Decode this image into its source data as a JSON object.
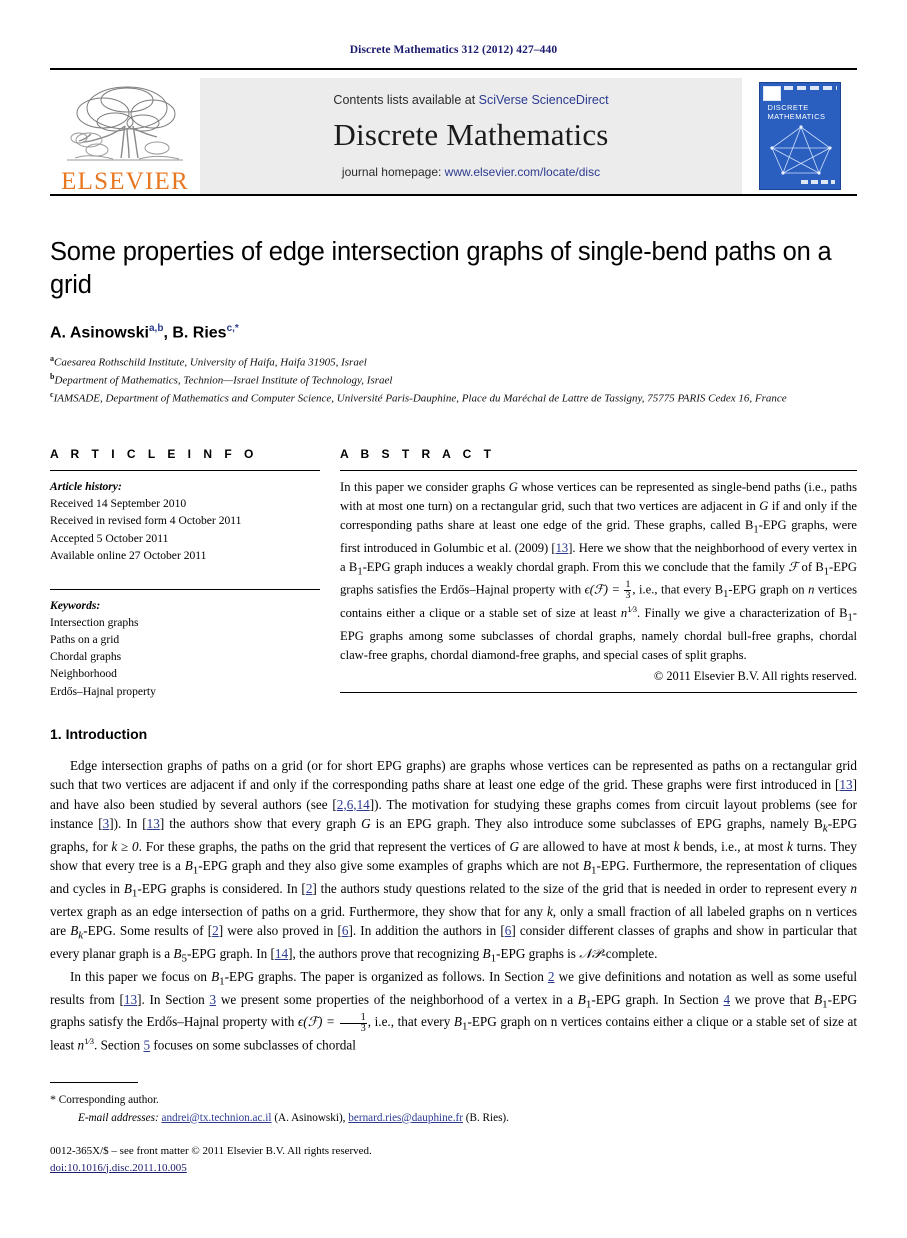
{
  "running_head": "Discrete Mathematics 312 (2012) 427–440",
  "masthead": {
    "contents_prefix": "Contents lists available at ",
    "contents_link": "SciVerse ScienceDirect",
    "journal_name": "Discrete Mathematics",
    "homepage_prefix": "journal homepage: ",
    "homepage_link": "www.elsevier.com/locate/disc",
    "publisher_wordmark": "ELSEVIER",
    "cover_title_line1": "DISCRETE",
    "cover_title_line2": "MATHEMATICS"
  },
  "article": {
    "title": "Some properties of edge intersection graphs of single-bend paths on a grid",
    "authors_plain": "A. Asinowski a,b, B. Ries c,*",
    "author1_name": "A. Asinowski",
    "author1_marks": "a,b",
    "author2_name": ", B. Ries",
    "author2_marks": "c,*",
    "affiliations": [
      {
        "mark": "a",
        "text": "Caesarea Rothschild Institute, University of Haifa, Haifa 31905, Israel"
      },
      {
        "mark": "b",
        "text": "Department of Mathematics, Technion—Israel Institute of Technology, Israel"
      },
      {
        "mark": "c",
        "text": "IAMSADE, Department of Mathematics and Computer Science, Université Paris-Dauphine, Place du Maréchal de Lattre de Tassigny, 75775 PARIS Cedex 16, France"
      }
    ]
  },
  "article_info": {
    "heading": "A R T I C L E   I N F O",
    "history_label": "Article history:",
    "history": [
      "Received 14 September 2010",
      "Received in revised form 4 October 2011",
      "Accepted 5 October 2011",
      "Available online 27 October 2011"
    ],
    "keywords_label": "Keywords:",
    "keywords": [
      "Intersection graphs",
      "Paths on a grid",
      "Chordal graphs",
      "Neighborhood",
      "Erdős–Hajnal property"
    ]
  },
  "abstract": {
    "heading": "A B S T R A C T",
    "p1a": "In this paper we consider graphs ",
    "p1_G1": "G",
    "p1b": " whose vertices can be represented as single-bend paths (i.e., paths with at most one turn) on a rectangular grid, such that two vertices are adjacent in ",
    "p1_G2": "G",
    "p1c": " if and only if the corresponding paths share at least one edge of the grid. These graphs, called B",
    "p1_sub1": "1",
    "p1d": "-EPG graphs, were first introduced in Golumbic et al. (2009) [",
    "p1_ref13": "13",
    "p1e": "]. Here we show that the neighborhood of every vertex in a B",
    "p1_sub2": "1",
    "p1f": "-EPG graph induces a weakly chordal graph. From this we conclude that the family ",
    "p1_F1": "ℱ",
    "p1g": " of B",
    "p1_sub3": "1",
    "p1h": "-EPG graphs satisfies the Erdős–Hajnal property with ",
    "p1_eps": "ϵ(ℱ) = ",
    "p1_frac_num": "1",
    "p1_frac_den": "3",
    "p1i": ", i.e., that every B",
    "p1_sub4": "1",
    "p1j": "-EPG graph on ",
    "p1_n1": "n",
    "p1k": " vertices contains either a clique or a stable set of size at least ",
    "p1_n2": "n",
    "p1l": ". Finally we give a characterization of B",
    "p1_sub5": "1",
    "p1m": "-EPG graphs among some subclasses of chordal graphs, namely chordal bull-free graphs, chordal claw-free graphs, chordal diamond-free graphs, and special cases of split graphs.",
    "copyright": "© 2011 Elsevier B.V. All rights reserved."
  },
  "body": {
    "section1_heading": "1. Introduction",
    "para1": [
      "Edge intersection graphs of paths on a grid (or for short EPG graphs) are graphs whose vertices can be represented as paths on a rectangular grid such that two vertices are adjacent if and only if the corresponding paths share at least one edge of the grid. These graphs were first introduced in [",
      "13",
      "] and have also been studied by several authors (see [",
      "2,6,14",
      "]). The motivation for studying these graphs comes from circuit layout problems (see for instance [",
      "3",
      "]). In [",
      "13",
      "] the authors show that every graph ",
      "G",
      " is an EPG graph. They also introduce some subclasses of EPG graphs, namely B",
      "k",
      "-EPG graphs, for ",
      "k ≥ 0",
      ". For these graphs, the paths on the grid that represent the vertices of ",
      "G",
      " are allowed to have at most ",
      "k",
      " bends, i.e., at most ",
      "k",
      " turns. They show that every tree is a ",
      "B",
      "1",
      "-EPG graph and they also give some examples of graphs which are not ",
      "B",
      "1",
      "-EPG. Furthermore, the representation of cliques and cycles in ",
      "B",
      "1",
      "-EPG graphs is considered. In [",
      "2",
      "] the authors study questions related to the size of the grid that is needed in order to represent every ",
      "n",
      " vertex graph as an edge intersection of paths on a grid. Furthermore, they show that for any ",
      "k",
      ", only a small fraction of all labeled graphs on n vertices are ",
      "B",
      "k",
      "-EPG. Some results of [",
      "2",
      "] were also proved in [",
      "6",
      "]. In addition the authors in [",
      "6",
      "] consider different classes of graphs and show in particular that every planar graph is a ",
      "B",
      "5",
      "-EPG graph. In [",
      "14",
      "], the authors prove that recognizing ",
      "B",
      "1",
      "-EPG graphs is ",
      "𝒩𝒫",
      "-complete."
    ],
    "para2": [
      "In this paper we focus on ",
      "B",
      "1",
      "-EPG graphs. The paper is organized as follows. In Section ",
      "2",
      " we give definitions and notation as well as some useful results from [",
      "13",
      "]. In Section ",
      "3",
      " we present some properties of the neighborhood of a vertex in a ",
      "B",
      "1",
      "-EPG graph. In Section ",
      "4",
      " we prove that ",
      "B",
      "1",
      "-EPG graphs satisfy the Erdős–Hajnal property with ",
      "ϵ(ℱ) = ",
      "1",
      "3",
      ", i.e., that every ",
      "B",
      "1",
      "-EPG graph on n vertices contains either a clique or a stable set of size at least ",
      "n",
      ". Section ",
      "5",
      " focuses on some subclasses of chordal"
    ]
  },
  "footnotes": {
    "corresponding_star": "*",
    "corresponding_text": "Corresponding author.",
    "email_label": "E-mail addresses:",
    "email1": "andrei@tx.technion.ac.il",
    "email1_owner": " (A. Asinowski),",
    "email2": "bernard.ries@dauphine.fr",
    "email2_owner": " (B. Ries).",
    "issn_line": "0012-365X/$ – see front matter © 2011 Elsevier B.V. All rights reserved.",
    "doi_line": "doi:10.1016/j.disc.2011.10.005"
  },
  "colors": {
    "link": "#2b3a8f",
    "running_head": "#1a1a6e",
    "elsevier_orange": "#E87722",
    "cover_blue": "#2a5fc0",
    "masthead_gray": "#ececec"
  }
}
